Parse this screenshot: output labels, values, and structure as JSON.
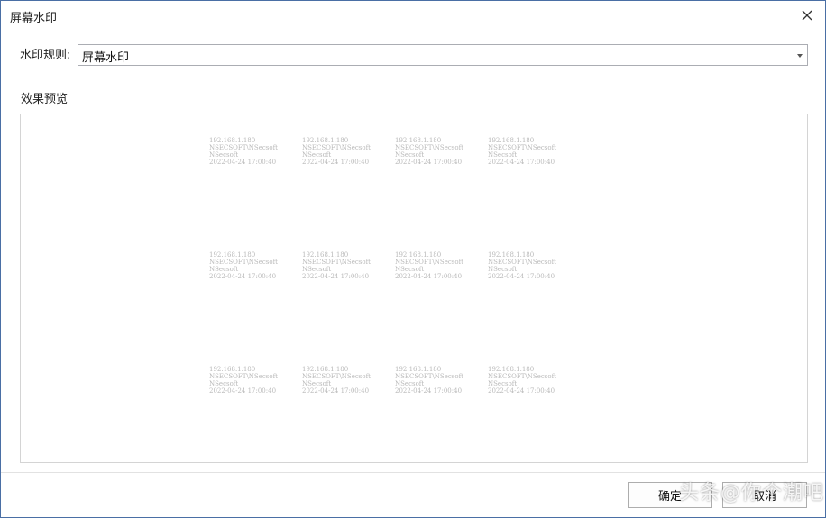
{
  "window": {
    "title": "屏幕水印"
  },
  "form": {
    "rule_label": "水印规则:",
    "rule_value": "屏幕水印"
  },
  "preview": {
    "label": "效果预览",
    "watermark_lines": [
      "192.168.1.180",
      "NSECSOFT\\NSecsoft",
      "NSecsoft",
      "2022-04-24 17:00:40"
    ]
  },
  "buttons": {
    "ok": "确定",
    "cancel": "取消"
  },
  "overlay": {
    "text": "头条@你个潮吧"
  },
  "colors": {
    "border": "#4a6fa5",
    "watermark_text": "#b9b9b9"
  }
}
